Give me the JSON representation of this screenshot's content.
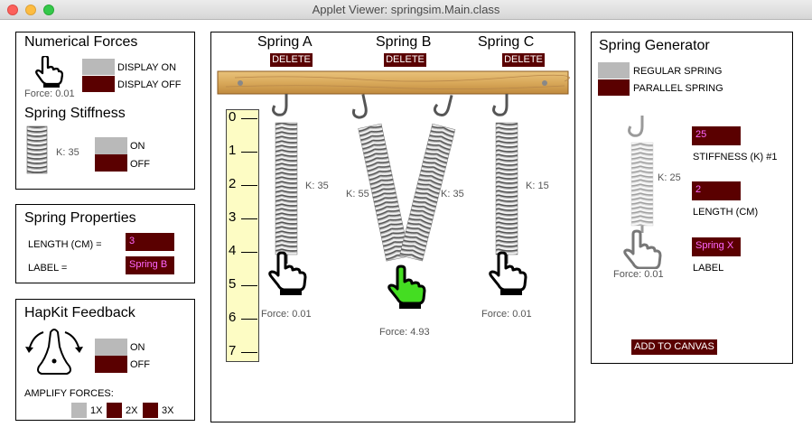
{
  "window": {
    "title": "Applet Viewer: springsim.Main.class"
  },
  "numerical_forces": {
    "title": "Numerical Forces",
    "force": "Force: 0.01",
    "display_on": "DISPLAY ON",
    "display_off": "DISPLAY OFF"
  },
  "spring_stiffness": {
    "title": "Spring Stiffness",
    "k": "K: 35",
    "on": "ON",
    "off": "OFF"
  },
  "spring_properties": {
    "title": "Spring Properties",
    "length_label": "LENGTH (CM) =",
    "length_value": "3",
    "label_label": "LABEL =",
    "label_value": "Spring B"
  },
  "hapkit": {
    "title": "HapKit Feedback",
    "on": "ON",
    "off": "OFF",
    "amplify": "AMPLIFY FORCES:",
    "x1": "1X",
    "x2": "2X",
    "x3": "3X"
  },
  "canvas": {
    "delete_label": "DELETE",
    "springs": [
      {
        "name": "Spring A",
        "k": "K: 35",
        "force": "Force: 0.01"
      },
      {
        "name": "Spring B",
        "k_left": "K: 55",
        "k_right": "K: 35",
        "force": "Force: 4.93"
      },
      {
        "name": "Spring C",
        "k": "K: 15",
        "force": "Force: 0.01"
      }
    ],
    "ruler": [
      "0",
      "1",
      "2",
      "3",
      "4",
      "5",
      "6",
      "7"
    ]
  },
  "generator": {
    "title": "Spring Generator",
    "regular": "REGULAR SPRING",
    "parallel": "PARALLEL SPRING",
    "k": "K: 25",
    "force": "Force: 0.01",
    "stiffness_value": "25",
    "stiffness_label": "STIFFNESS (K) #1",
    "length_value": "2",
    "length_label": "LENGTH (CM)",
    "label_value": "Spring X",
    "label_label": "LABEL",
    "add": "ADD TO CANVAS"
  },
  "colors": {
    "dark": "#5a0000",
    "gray": "#b9b9b9",
    "ruler": "#fdfcc4",
    "active_hand": "#44dd22",
    "field_text": "#ff66ff"
  }
}
